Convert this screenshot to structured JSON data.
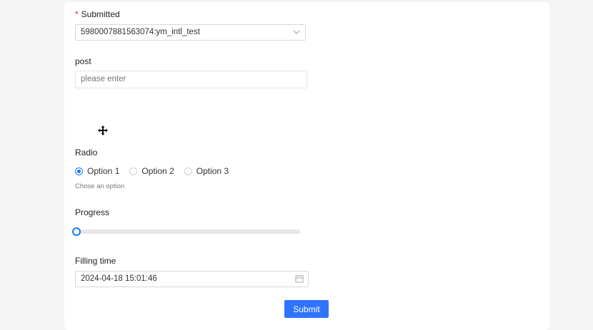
{
  "form": {
    "submitted": {
      "required_mark": "*",
      "label": "Submitted",
      "value": "5980007881563074:ym_intl_test",
      "icon": "chevron-down-icon"
    },
    "post": {
      "label": "post",
      "placeholder": "please enter",
      "value": ""
    },
    "radio": {
      "label": "Radio",
      "options": [
        "Option 1",
        "Option 2",
        "Option 3"
      ],
      "selected": "Option 1",
      "hint": "Chose an option"
    },
    "progress": {
      "label": "Progress",
      "value": 0
    },
    "filling_time": {
      "label": "Filling time",
      "value": "2024-04-18 15:01:46",
      "icon": "calendar-icon"
    },
    "submit_label": "Submit"
  },
  "colors": {
    "primary": "#1677ff",
    "button": "#2f73ff",
    "required": "#f5222d",
    "page_background": "#f5f5f5"
  }
}
